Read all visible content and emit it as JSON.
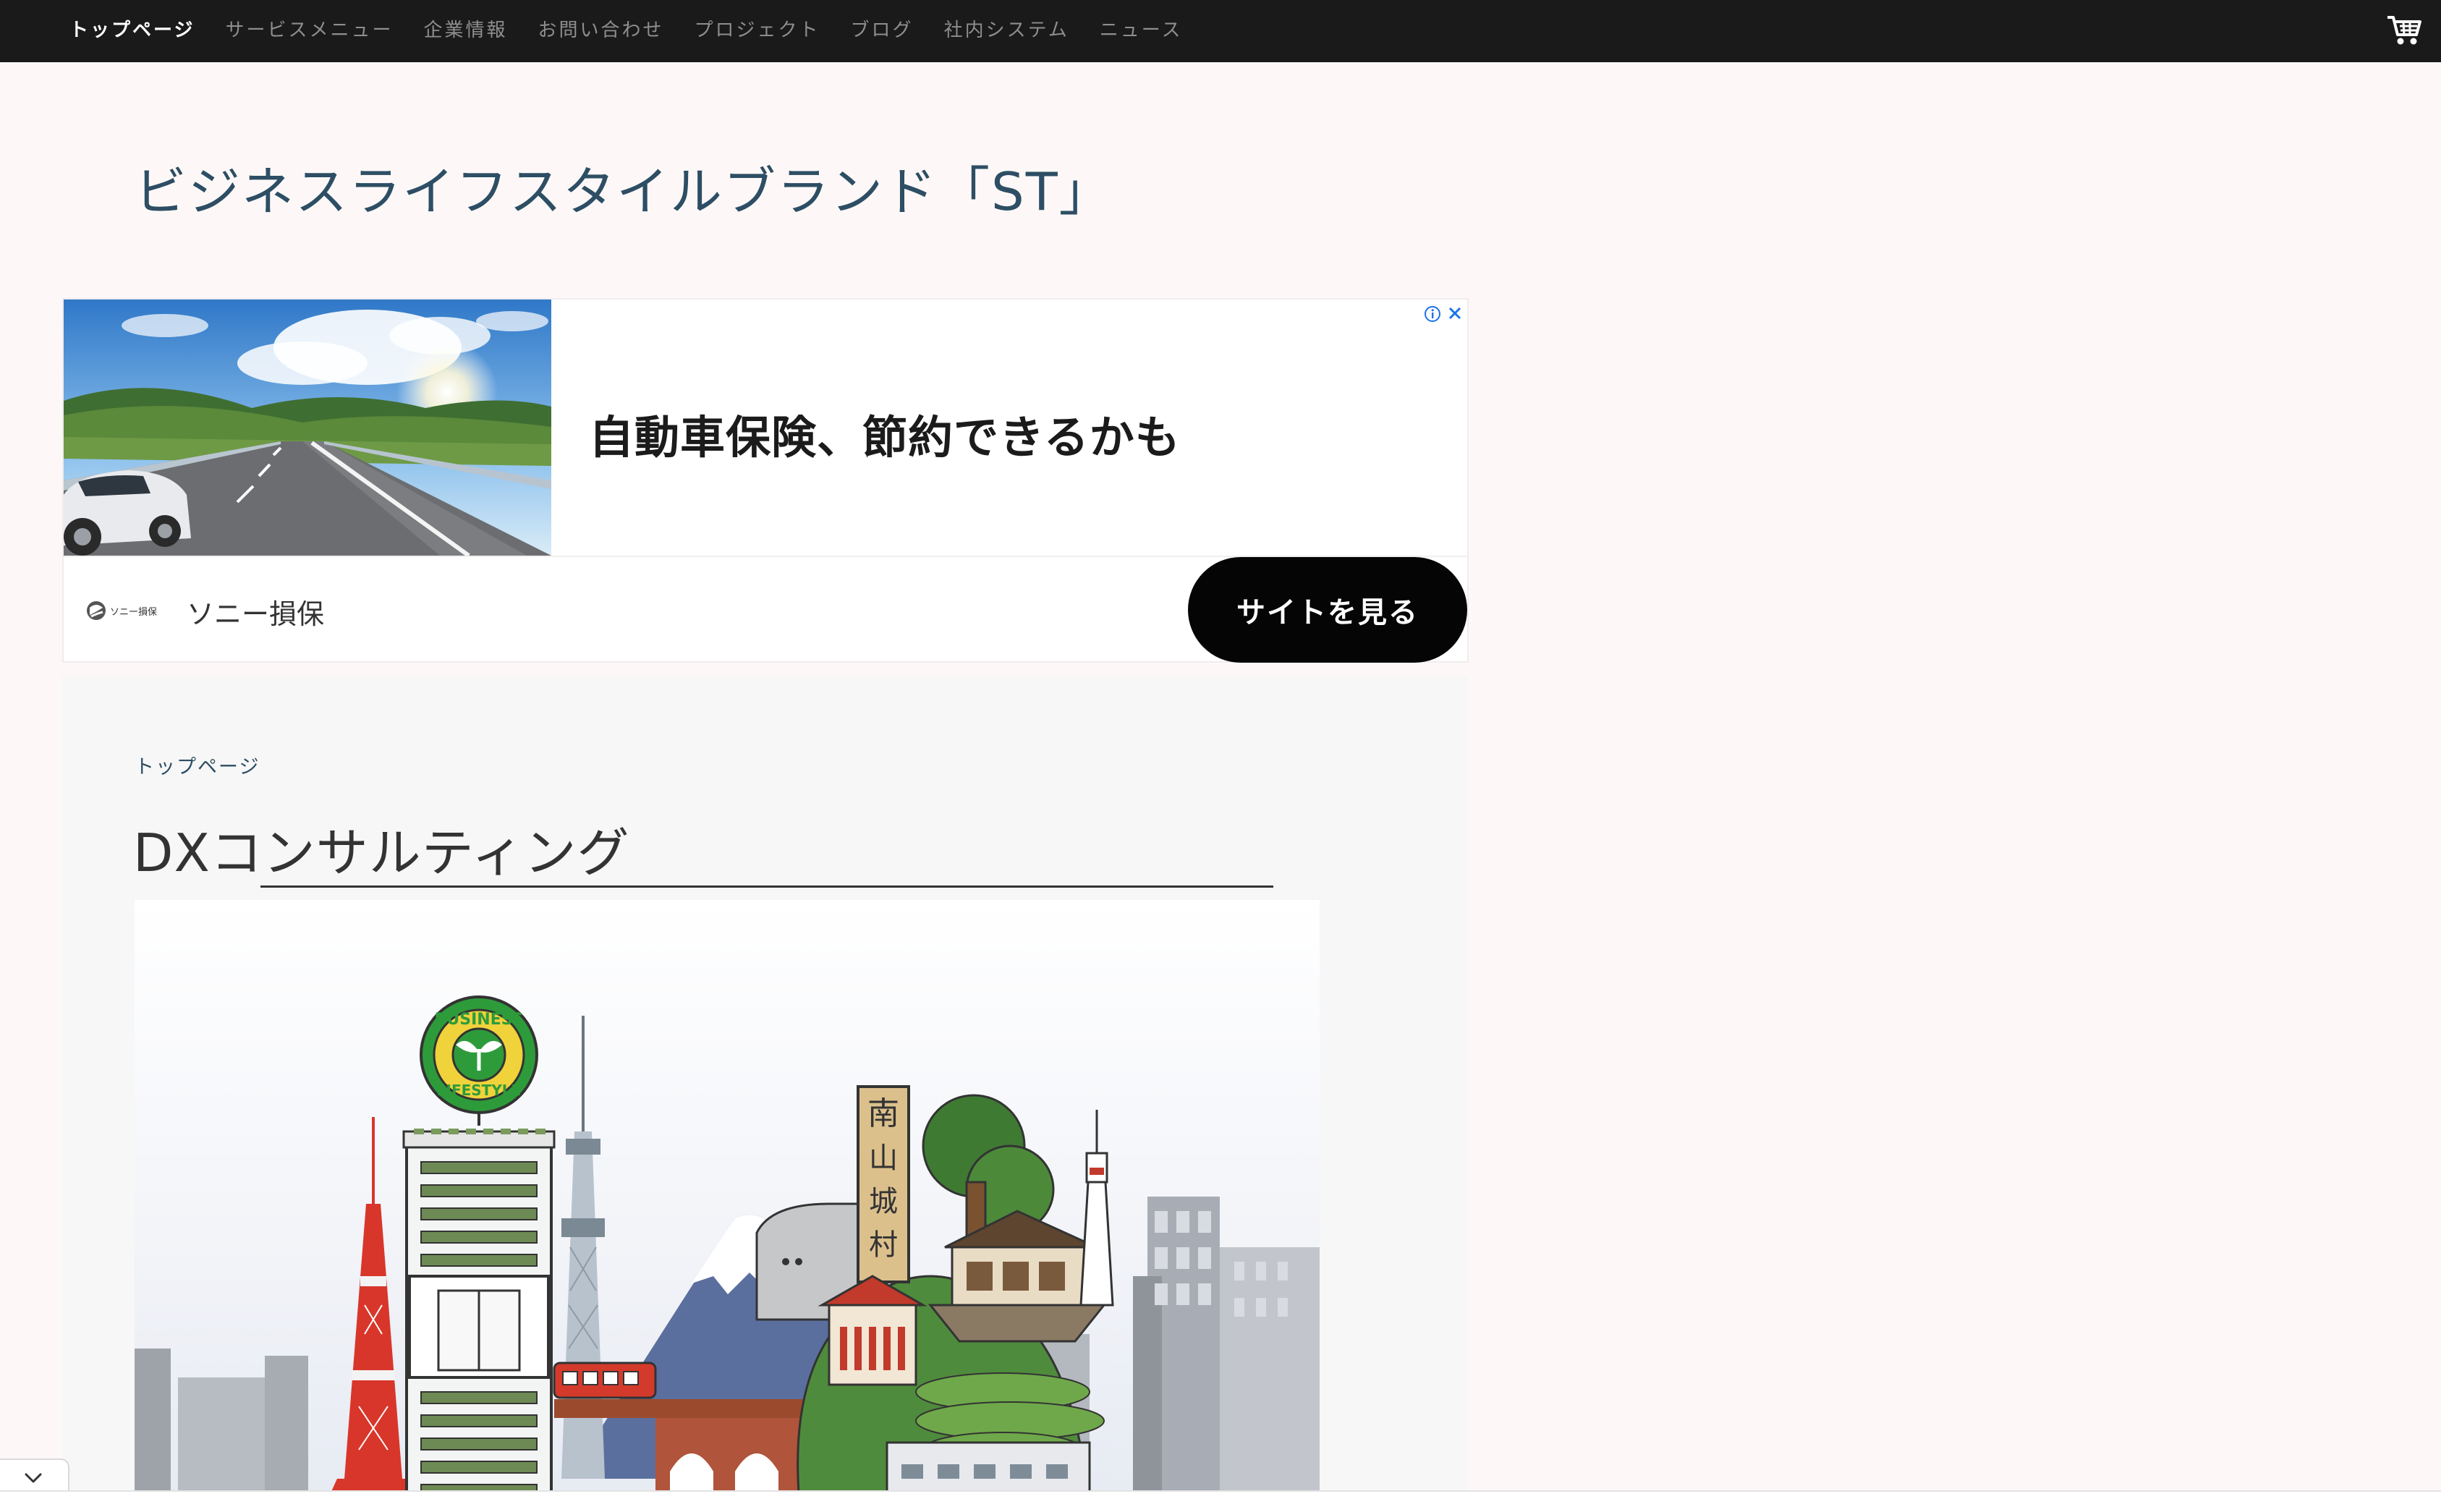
{
  "nav": {
    "items": [
      {
        "label": "トップページ",
        "active": true
      },
      {
        "label": "サービスメニュー",
        "active": false
      },
      {
        "label": "企業情報",
        "active": false
      },
      {
        "label": "お問い合わせ",
        "active": false
      },
      {
        "label": "プロジェクト",
        "active": false
      },
      {
        "label": "ブログ",
        "active": false
      },
      {
        "label": "社内システム",
        "active": false
      },
      {
        "label": "ニュース",
        "active": false
      }
    ],
    "cart_icon": "shopping-cart-icon"
  },
  "site": {
    "title": "ビジネスライフスタイルブランド「ST」"
  },
  "ad": {
    "headline": "自動車保険、節約できるかも",
    "brand": "ソニー損保",
    "cta": "サイトを見る",
    "logo_text": "ソニー損保",
    "info_icon": "info-icon",
    "close_icon": "close-icon"
  },
  "main": {
    "breadcrumb": "トップページ",
    "page_title": "DXコンサルティング",
    "hero": {
      "badge_text_top": "BUSINESS",
      "badge_text_bottom": "LIFESTYLE",
      "sign_text": "南山城村"
    }
  },
  "colors": {
    "nav_bg": "#1a1a1a",
    "title": "#2d4e64",
    "page_bg": "#fdf8f7",
    "cta_bg": "#050505",
    "badge_green": "#2e9b3b",
    "tower_red": "#d9362b"
  }
}
